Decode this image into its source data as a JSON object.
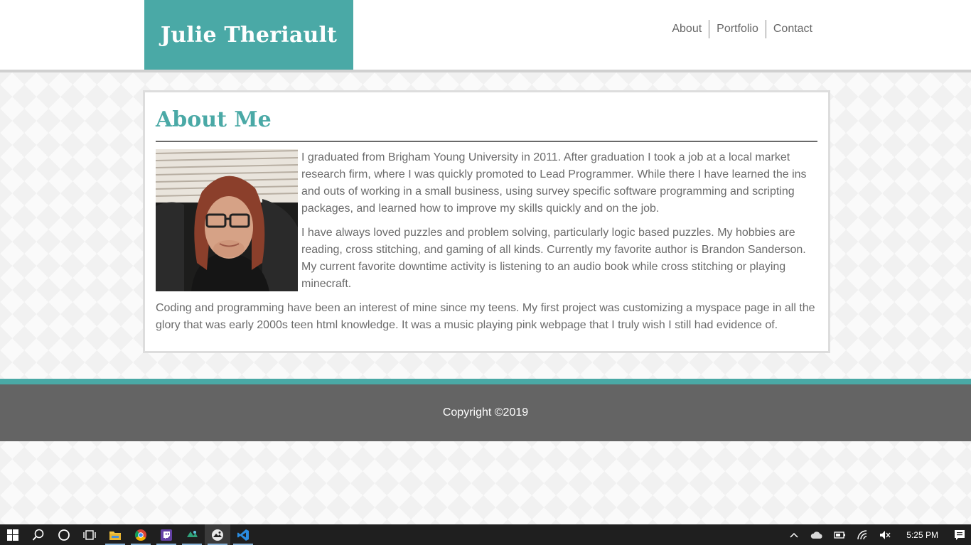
{
  "header": {
    "brand_name": "Julie Theriault",
    "nav": [
      "About",
      "Portfolio",
      "Contact"
    ]
  },
  "about": {
    "title": "About Me",
    "paragraphs": [
      "I graduated from Brigham Young University in 2011. After graduation I took a job at a local market research firm, where I was quickly promoted to Lead Programmer. While there I have learned the ins and outs of working in a small business, using survey specific software programming and scripting packages, and learned how to improve my skills quickly and on the job.",
      "I have always loved puzzles and problem solving, particularly logic based puzzles. My hobbies are reading, cross stitching, and gaming of all kinds. Currently my favorite author is Brandon Sanderson. My current favorite downtime activity is listening to an audio book while cross stitching or playing minecraft.",
      "Coding and programming have been an interest of mine since my teens. My first project was customizing a myspace page in all the glory that was early 2000s teen html knowledge. It was a music playing pink webpage that I truly wish I still had evidence of."
    ]
  },
  "footer": {
    "copyright": "Copyright ©2019"
  },
  "taskbar": {
    "apps": [
      "start-icon",
      "search-icon",
      "cortana-icon",
      "task-view-icon",
      "file-explorer-icon",
      "chrome-icon",
      "twitch-icon",
      "app-icon",
      "photos-icon",
      "vscode-icon"
    ],
    "clock": "5:25 PM"
  },
  "colors": {
    "accent": "#4aa9a6",
    "footer_bg": "#646464",
    "text": "#6b6b6b",
    "taskbar_bg": "#1f1f1f"
  }
}
